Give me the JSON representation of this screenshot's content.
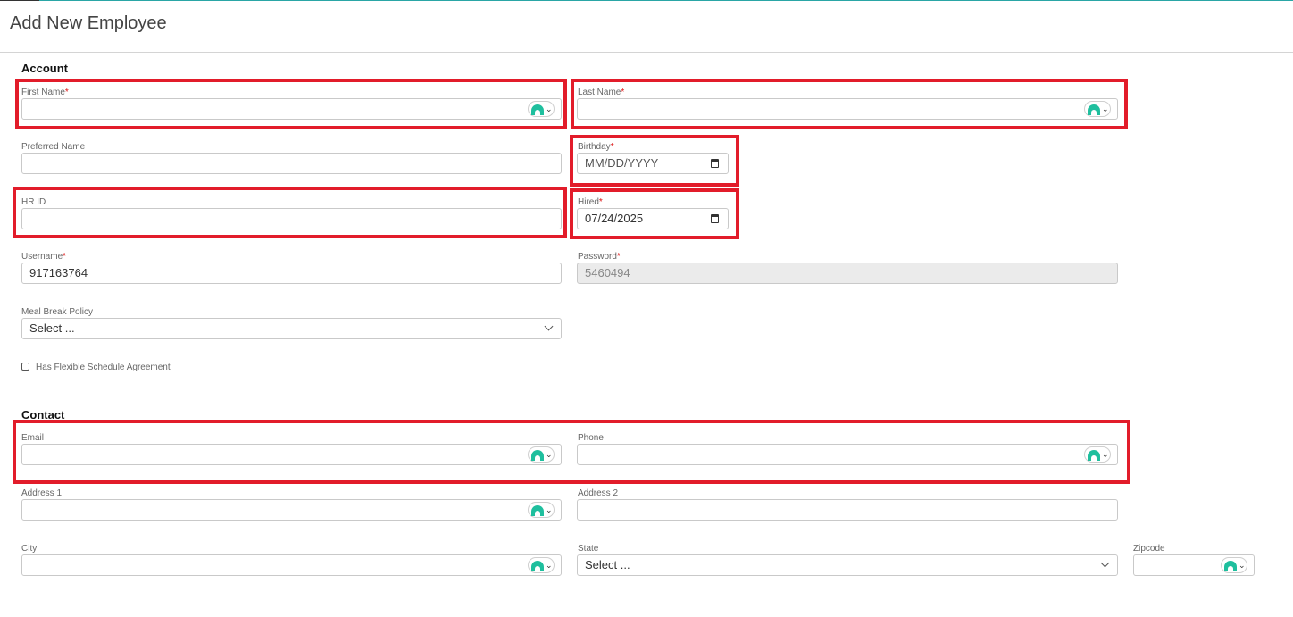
{
  "page": {
    "title": "Add New Employee"
  },
  "account": {
    "section_title": "Account",
    "first_name": {
      "label": "First Name",
      "required": "*",
      "value": ""
    },
    "last_name": {
      "label": "Last Name",
      "required": "*",
      "value": ""
    },
    "preferred_name": {
      "label": "Preferred Name",
      "value": ""
    },
    "birthday": {
      "label": "Birthday",
      "required": "*",
      "value": "MM/DD/YYYY"
    },
    "hr_id": {
      "label": "HR ID",
      "value": ""
    },
    "hired": {
      "label": "Hired",
      "required": "*",
      "value": "07/24/2025"
    },
    "username": {
      "label": "Username",
      "required": "*",
      "value": "917163764"
    },
    "password": {
      "label": "Password",
      "required": "*",
      "value": "5460494"
    },
    "meal_break_policy": {
      "label": "Meal Break Policy",
      "selected": "Select ..."
    },
    "flexible_schedule": {
      "label": "Has Flexible Schedule Agreement",
      "checked": false
    }
  },
  "contact": {
    "section_title": "Contact",
    "email": {
      "label": "Email",
      "value": ""
    },
    "phone": {
      "label": "Phone",
      "value": ""
    },
    "address1": {
      "label": "Address 1",
      "value": ""
    },
    "address2": {
      "label": "Address 2",
      "value": ""
    },
    "city": {
      "label": "City",
      "value": ""
    },
    "state": {
      "label": "State",
      "selected": "Select ..."
    },
    "zipcode": {
      "label": "Zipcode",
      "value": ""
    }
  },
  "icons": {
    "field_extension": "autofill-extension-icon",
    "calendar": "calendar-icon",
    "dropdown": "chevron-down-icon"
  },
  "colors": {
    "highlight": "#e21c2a",
    "required": "#dd1111",
    "accent_line": "#2aa6a6",
    "extension_icon": "#1fbf9e"
  }
}
